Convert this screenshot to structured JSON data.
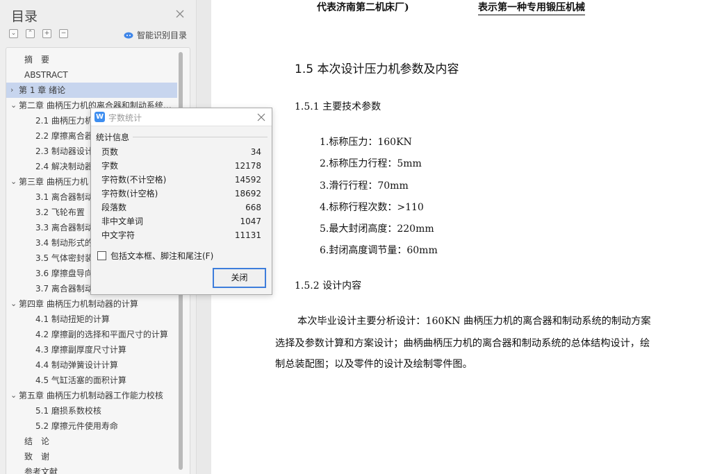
{
  "toc": {
    "title": "目录",
    "toolbar": {
      "collapse_all": "⌄",
      "expand_up": "⌃",
      "add": "+",
      "remove": "−",
      "smart_toc_label": "智能识别目录"
    },
    "items": [
      {
        "label": "摘　要",
        "level": 0,
        "arrow": ""
      },
      {
        "label": "ABSTRACT",
        "level": 0,
        "arrow": ""
      },
      {
        "label": "第 1 章  绪论",
        "level": 0,
        "arrow": "›",
        "selected": true
      },
      {
        "label": "第二章  曲柄压力机的离合器和制动系统的制动方案",
        "level": 0,
        "arrow": "⌄"
      },
      {
        "label": "2.1 曲柄压力机",
        "level": 1,
        "arrow": ""
      },
      {
        "label": "2.2  摩擦离合器",
        "level": 1,
        "arrow": ""
      },
      {
        "label": "2.3  制动器设计",
        "level": 1,
        "arrow": ""
      },
      {
        "label": "2.4  解决制动器",
        "level": 1,
        "arrow": ""
      },
      {
        "label": "第三章  曲柄压力机",
        "level": 0,
        "arrow": "⌄"
      },
      {
        "label": "3.1  离合器制动",
        "level": 1,
        "arrow": ""
      },
      {
        "label": "3.2  飞轮布置",
        "level": 1,
        "arrow": ""
      },
      {
        "label": "3.3  离合器制动",
        "level": 1,
        "arrow": ""
      },
      {
        "label": "3.4  制动形式的",
        "level": 1,
        "arrow": ""
      },
      {
        "label": "3.5  气体密封装",
        "level": 1,
        "arrow": ""
      },
      {
        "label": "3.6  摩擦盘导向",
        "level": 1,
        "arrow": ""
      },
      {
        "label": "3.7  离合器制动",
        "level": 1,
        "arrow": ""
      },
      {
        "label": "第四章  曲柄压力机制动器的计算",
        "level": 0,
        "arrow": "⌄"
      },
      {
        "label": "4.1  制动扭矩的计算",
        "level": 1,
        "arrow": ""
      },
      {
        "label": "4.2  摩擦副的选择和平面尺寸的计算",
        "level": 1,
        "arrow": ""
      },
      {
        "label": "4.3  摩擦副厚度尺寸计算",
        "level": 1,
        "arrow": ""
      },
      {
        "label": "4.4  制动弹簧设计计算",
        "level": 1,
        "arrow": ""
      },
      {
        "label": "4.5  气缸活塞的面积计算",
        "level": 1,
        "arrow": ""
      },
      {
        "label": "第五章  曲柄压力机制动器工作能力校核",
        "level": 0,
        "arrow": "⌄"
      },
      {
        "label": "5.1 磨损系数校核",
        "level": 1,
        "arrow": ""
      },
      {
        "label": "5.2  摩擦元件使用寿命",
        "level": 1,
        "arrow": ""
      },
      {
        "label": "结　论",
        "level": 0,
        "arrow": ""
      },
      {
        "label": "致　谢",
        "level": 0,
        "arrow": ""
      },
      {
        "label": "参考文献",
        "level": 0,
        "arrow": ""
      }
    ]
  },
  "document": {
    "continuation_left": "代表济南第二机床厂)",
    "continuation_right": "表示第一种专用锻压机械",
    "section_heading": "1.5 本次设计压力机参数及内容",
    "subsection_1": "1.5.1 主要技术参数",
    "params": [
      "1.标称压力：160KN",
      "2.标称压力行程：5mm",
      "3.滑行行程：70mm",
      "4.标称行程次数：>110",
      "5.最大封闭高度：220mm",
      "6.封闭高度调节量：60mm"
    ],
    "subsection_2": "1.5.2 设计内容",
    "paragraph_lines": [
      "本次毕业设计主要分析设计：160KN 曲柄压力机的离合器和制动系统的制动方案",
      "选择及参数计算和方案设计；曲柄曲柄压力机的离合器和制动系统的总体结构设计，绘",
      "制总装配图；以及零件的设计及绘制零件图。"
    ]
  },
  "word_count_dialog": {
    "logo_glyph": "W",
    "title": "字数统计",
    "section_label": "统计信息",
    "rows": [
      {
        "key": "页数",
        "value": "34"
      },
      {
        "key": "字数",
        "value": "12178"
      },
      {
        "key": "字符数(不计空格)",
        "value": "14592"
      },
      {
        "key": "字符数(计空格)",
        "value": "18692"
      },
      {
        "key": "段落数",
        "value": "668"
      },
      {
        "key": "非中文单词",
        "value": "1047"
      },
      {
        "key": "中文字符",
        "value": "11131"
      }
    ],
    "checkbox_label": "包括文本框、脚注和尾注(F)",
    "checkbox_checked": false,
    "close_button": "关闭"
  },
  "colors": {
    "selection": "#c7d5ee",
    "dialog_button_border": "#3d7ddb",
    "wps_logo": "#3e8ef0"
  }
}
